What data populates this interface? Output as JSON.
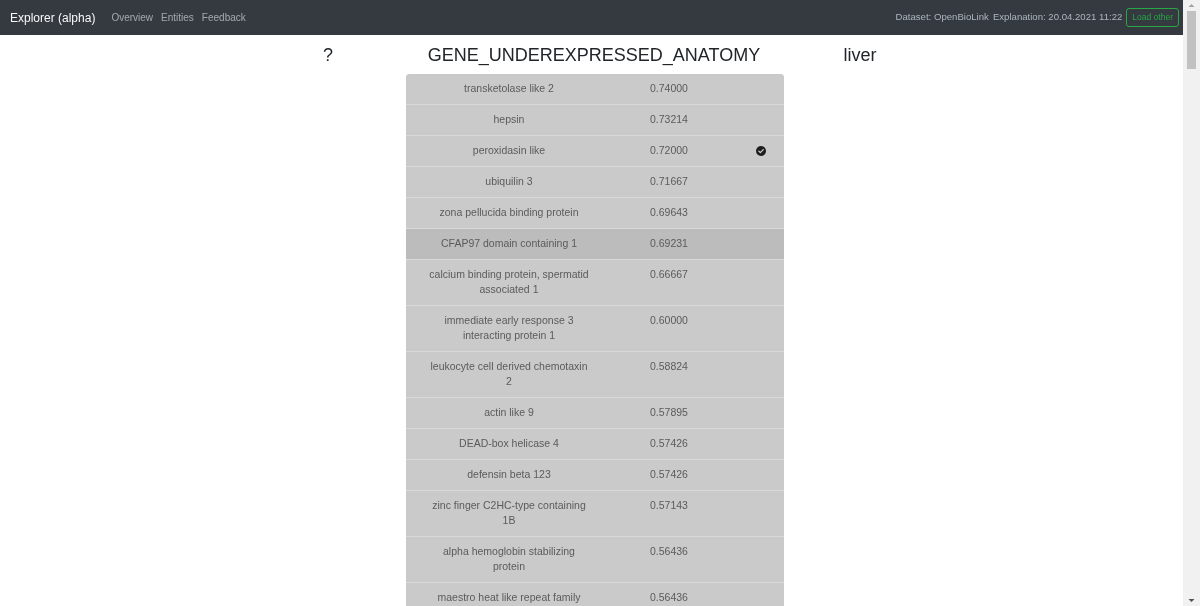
{
  "navbar": {
    "brand": "Explorer (alpha)",
    "links": [
      "Overview",
      "Entities",
      "Feedback"
    ],
    "dataset": "Dataset: OpenBioLink",
    "explanation": "Explanation: 20.04.2021 11:22",
    "button": "Load other"
  },
  "query": {
    "subject": "?",
    "relation": "GENE_UNDEREXPRESSED_ANATOMY",
    "object": "liver"
  },
  "table": {
    "rows": [
      {
        "name": "transketolase like 2",
        "score": "0.74000",
        "checked": false,
        "highlighted": false
      },
      {
        "name": "hepsin",
        "score": "0.73214",
        "checked": false,
        "highlighted": false
      },
      {
        "name": "peroxidasin like",
        "score": "0.72000",
        "checked": true,
        "highlighted": false
      },
      {
        "name": "ubiquilin 3",
        "score": "0.71667",
        "checked": false,
        "highlighted": false
      },
      {
        "name": "zona pellucida binding protein",
        "score": "0.69643",
        "checked": false,
        "highlighted": false
      },
      {
        "name": "CFAP97 domain containing 1",
        "score": "0.69231",
        "checked": false,
        "highlighted": true
      },
      {
        "name": "calcium binding protein, spermatid associated 1",
        "score": "0.66667",
        "checked": false,
        "highlighted": false
      },
      {
        "name": "immediate early response 3 interacting protein 1",
        "score": "0.60000",
        "checked": false,
        "highlighted": false
      },
      {
        "name": "leukocyte cell derived chemotaxin 2",
        "score": "0.58824",
        "checked": false,
        "highlighted": false
      },
      {
        "name": "actin like 9",
        "score": "0.57895",
        "checked": false,
        "highlighted": false
      },
      {
        "name": "DEAD-box helicase 4",
        "score": "0.57426",
        "checked": false,
        "highlighted": false
      },
      {
        "name": "defensin beta 123",
        "score": "0.57426",
        "checked": false,
        "highlighted": false
      },
      {
        "name": "zinc finger C2HC-type containing 1B",
        "score": "0.57143",
        "checked": false,
        "highlighted": false
      },
      {
        "name": "alpha hemoglobin stabilizing protein",
        "score": "0.56436",
        "checked": false,
        "highlighted": false
      },
      {
        "name": "maestro heat like repeat family",
        "score": "0.56436",
        "checked": false,
        "highlighted": false
      }
    ]
  }
}
